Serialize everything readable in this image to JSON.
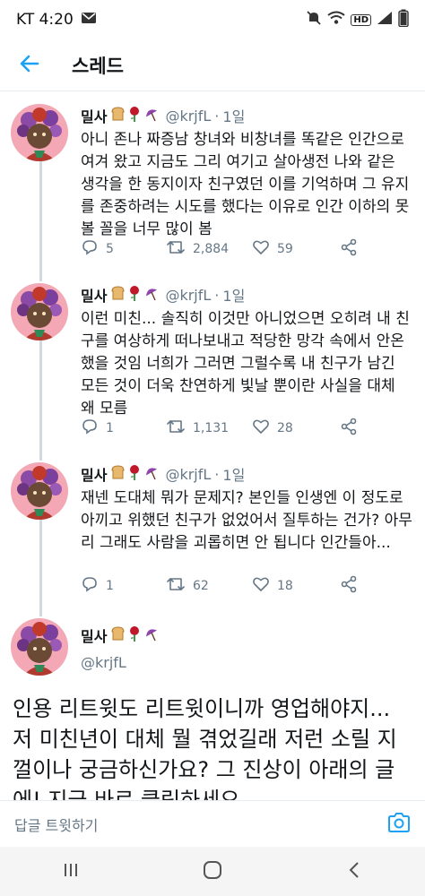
{
  "status_bar": {
    "carrier_time": "KT 4:20",
    "icons": [
      "mail-icon",
      "mute-icon",
      "wifi-icon",
      "hd-icon",
      "signal-icon",
      "battery-icon"
    ],
    "hd_label": "HD"
  },
  "header": {
    "title": "스레드"
  },
  "colors": {
    "accent": "#1da1f2",
    "secondary_text": "#657786",
    "divider": "#e6ecf0"
  },
  "tweets": [
    {
      "name": "밀사",
      "handle": "@krjfL",
      "dot": "·",
      "time": "1일",
      "text": "아니 존나 짜증남 창녀와 비창녀를 똑같은 인간으로 여겨 왔고 지금도 그리 여기고 살아생전 나와 같은 생각을 한 동지이자 친구였던 이를 기억하며 그 유지를 존중하려는 시도를 했다는 이유로 인간 이하의 못볼 꼴을 너무 많이 봄",
      "replies": "5",
      "retweets": "2,884",
      "likes": "59"
    },
    {
      "name": "밀사",
      "handle": "@krjfL",
      "dot": "·",
      "time": "1일",
      "text": "이런 미친... 솔직히 이것만 아니었으면 오히려 내 친구를 여상하게 떠나보내고 적당한 망각 속에서 안온했을 것임 너희가 그러면 그럴수록 내 친구가 남긴 모든 것이 더욱 찬연하게 빛날 뿐이란 사실을 대체 왜 모름",
      "replies": "1",
      "retweets": "1,131",
      "likes": "28"
    },
    {
      "name": "밀사",
      "handle": "@krjfL",
      "dot": "·",
      "time": "1일",
      "text": "재넨 도대체 뭐가 문제지? 본인들 인생엔 이 정도로 아끼고 위했던 친구가 없었어서 질투하는 건가? 아무리 그래도 사람을 괴롭히면 안 됩니다 인간들아...",
      "replies": "1",
      "retweets": "62",
      "likes": "18"
    }
  ],
  "main_tweet": {
    "name": "밀사",
    "handle": "@krjfL",
    "text": "인용 리트윗도 리트윗이니까 영업해야지... 저 미친년이 대체 뭘 겪었길래 저런 소릴 지껄이나 궁금하신가요? 그 진상이 아래의 글에! 지금 바로 클릭하세요"
  },
  "reply_bar": {
    "placeholder": "답글 트윗하기"
  },
  "nav_bar": {
    "buttons": [
      "recent-apps",
      "home",
      "back"
    ]
  }
}
